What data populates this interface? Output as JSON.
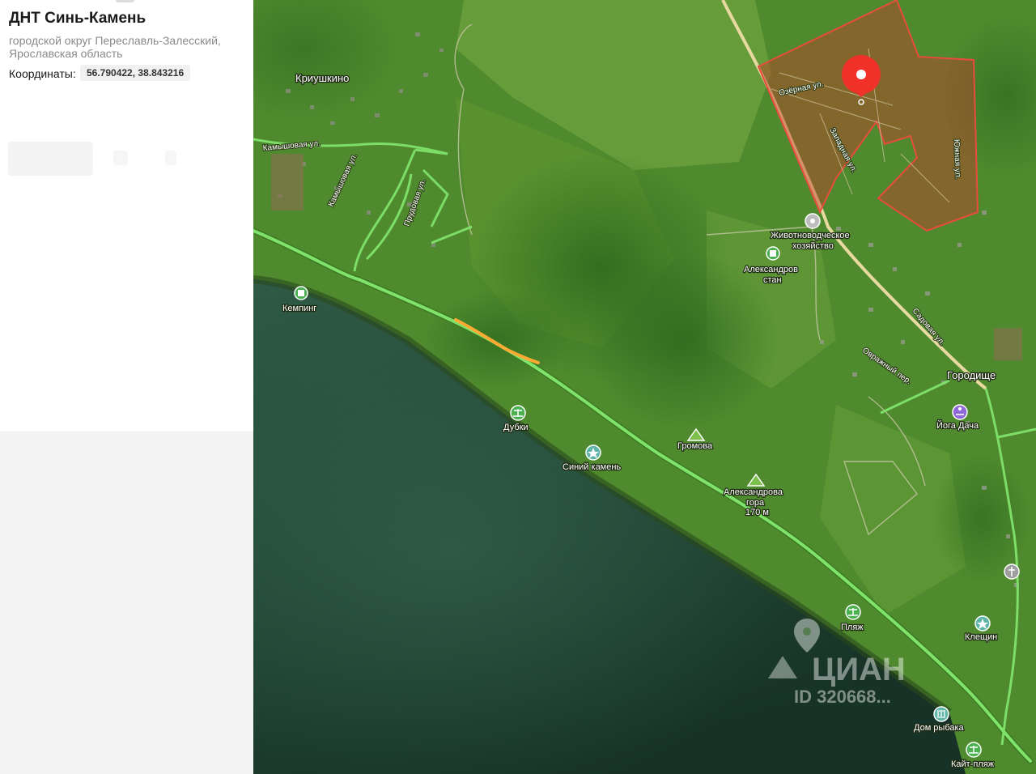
{
  "panel": {
    "title": "ДНТ Синь-Камень",
    "address": "городской округ Переславль-Залесский, Ярославская область",
    "coords_label": "Координаты:",
    "coords_value": "56.790422, 38.843216"
  },
  "map": {
    "places": {
      "kriushkino": "Криушкино",
      "gorodishche": "Городище"
    },
    "pois": {
      "kemping": "Кемпинг",
      "dubki": "Дубки",
      "sinij_kamen": "Синий камень",
      "gromova": "Громова",
      "aleksandrova_gora_1": "Александрова",
      "aleksandrova_gora_2": "гора",
      "aleksandrova_gora_3": "170 м",
      "zhivotnovod_1": "Животноводческое",
      "zhivotnovod_2": "хозяйство",
      "aleksandrov_stan_1": "Александров",
      "aleksandrov_stan_2": "стан",
      "yoga_dacha": "Йога Дача",
      "plyazh": "Пляж",
      "kleshchin": "Клещин",
      "dom_rybaka": "Дом рыбака",
      "kajt_plyazh": "Кайт-пляж"
    },
    "streets": {
      "ozernaya": "Озёрная ул.",
      "zapadnaya": "Западная ул.",
      "yuzhnaya": "Южная ул.",
      "sadovaya": "Садовая ул.",
      "ovrazhny": "Овражный пер.",
      "kamyshovaya": "Камышовая ул.",
      "kamyshovaya2": "Камышовая ул.",
      "prudovaya": "Прудовая ул."
    },
    "watermark": {
      "brand": "ЦИАН",
      "id": "ID 320668..."
    },
    "colors": {
      "plot_fill": "#c0392b",
      "marker": "#f0312a",
      "traffic_green": "#7fe36b",
      "traffic_orange": "#ffaa33"
    }
  }
}
